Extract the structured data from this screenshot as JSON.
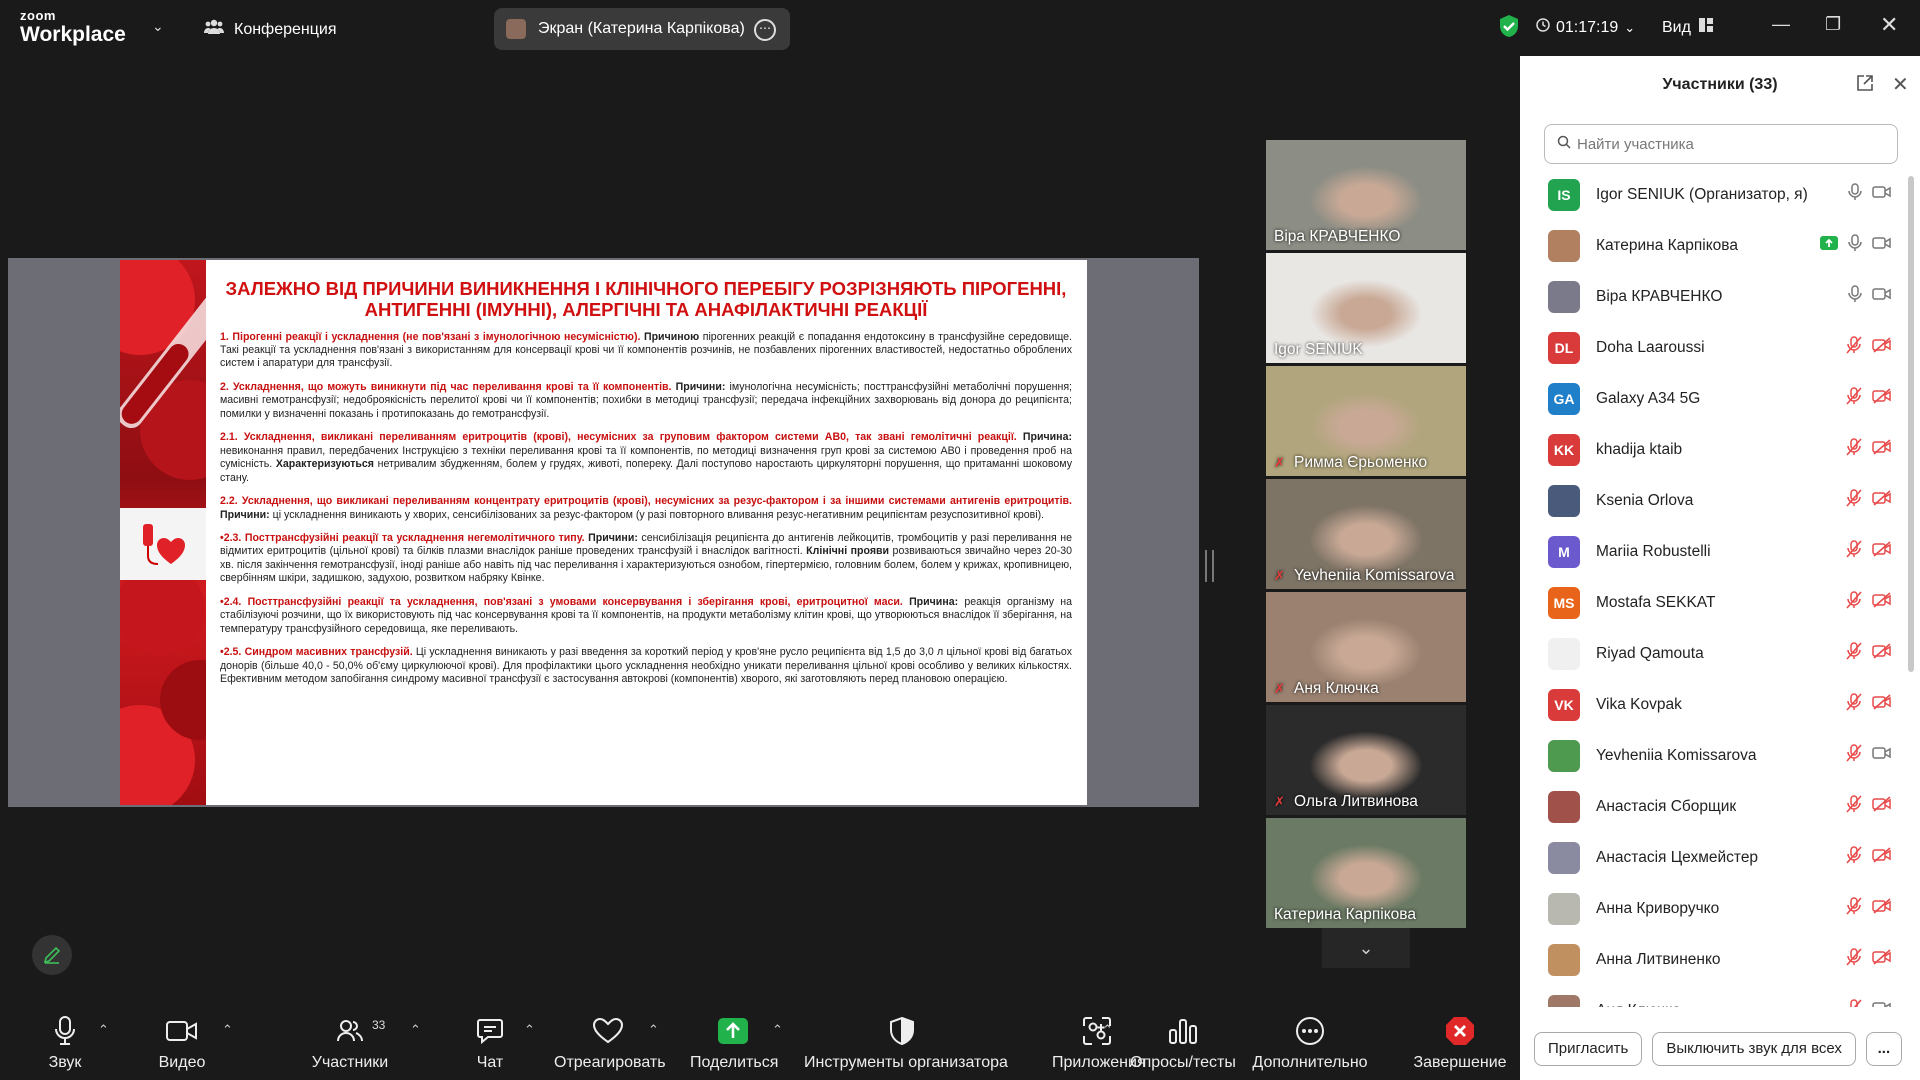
{
  "app": {
    "logo_line1": "zoom",
    "logo_line2": "Workplace",
    "meeting_label": "Конференция",
    "share_pill": "Экран (Катерина Карпікова)",
    "timer": "01:17:19",
    "view_label": "Вид"
  },
  "slide": {
    "title": "ЗАЛЕЖНО ВІД ПРИЧИНИ ВИНИКНЕННЯ І КЛІНІЧНОГО ПЕРЕБІГУ РОЗРІЗНЯЮТЬ ПІРОГЕННІ, АНТИГЕННІ (ІМУННІ), АЛЕРГІЧНІ ТА АНАФІЛАКТИЧНІ РЕАКЦІЇ",
    "p1_head": "1. Пірогенні реакції і ускладнення (не пов'язані з імунологічною несумісністю).",
    "p1_label": " Причиною",
    "p1_text": " пірогенних реакцій є попадання ендотоксину в трансфузійне середовище. Такі реакції та ускладнення пов'язані з використанням для консервації крові чи її компонентів розчинів, не позбавлених пірогенних властивостей, недостатньо оброблених систем і апаратури для трансфузії.",
    "p2_head": "2. Ускладнення, що можуть виникнути під час переливання крові та її компонентів.",
    "p2_label": " Причини:",
    "p2_text": " імунологічна несумісність; посттрансфузійні метаболічні порушення; масивні гемотрансфузії; недоброякісність перелитої крові чи її компонентів; похибки в методиці трансфузії; передача інфекційних захворювань від донора до реципієнта; помилки у визначенні показань і протипоказань до гемотрансфузії.",
    "p21_head": "2.1. Ускладнення, викликані переливанням еритроцитів (крові), несумісних за груповим фактором системи АВ0, так звані гемолітичні реакції.",
    "p21_label": " Причина:",
    "p21_text": " невиконання правил, передбачених Інструкцією з техніки переливання крові та її компонентів, по методиці визначення груп крові за системою АВ0 і проведення проб на сумісність.",
    "p21_label2": " Характеризуються",
    "p21_text2": " нетривалим збудженням, болем у грудях, животі, попереку. Далі поступово наростають циркуляторні порушення, що притаманні шоковому стану.",
    "p22_head": "2.2. Ускладнення, що викликані переливанням концентрату еритроцитів (крові), несумісних за резус-фактором і за іншими системами антигенів еритроцитів.",
    "p22_label": " Причини:",
    "p22_text": " ці ускладнення виникають у хворих, сенсибілізованих за резус-фактором (у разі повторного вливання резус-негативним реципієнтам резуспозитивної крові).",
    "p23_head": "•2.3. Посттрансфузійні реакції та ускладнення негемолітичного типу.",
    "p23_label": " Причини:",
    "p23_text": " сенсибілізація реципієнта до антигенів лейкоцитів, тромбоцитів у разі переливання не відмитих еритроцитів (цільної крові) та білків плазми внаслідок раніше проведених трансфузій і внаслідок вагітності.",
    "p23_label2": " Клінічні прояви",
    "p23_text2": " розвиваються звичайно через 20-30 хв. після закінчення гемотрансфузії, іноді раніше або навіть під час переливання і характеризуються ознобом, гіпертермією, головним болем, болем у крижах, кропивницею, свербінням шкіри, задишкою, задухою, розвитком набряку Квінке.",
    "p24_head": "•2.4. Посттрансфузійні реакції та ускладнення, пов'язані з умовами консервування і зберігання крові, еритроцитної маси.",
    "p24_label": " Причина:",
    "p24_text": " реакція організму на стабілізуючі розчини, що їх використовують під час консервування крові та її компонентів, на продукти метаболізму клітин крові, що утворюються внаслідок її зберігання, на температуру трансфузійного середовища, яке переливають.",
    "p25_head": "•2.5. Синдром масивних трансфузій.",
    "p25_text": " Ці ускладнення виникають у разі введення за короткий період у кров'яне русло реципієнта від 1,5 до 3,0 л цільної крові від багатьох донорів (більше 40,0 - 50,0% об'єму циркулюючої крові). Для профілактики цього ускладнення необхідно уникати переливання цільної крові особливо у великих кількостях. Ефективним методом запобігання синдрому масивної трансфузії є застосування автокрові (компонентів) хворого, які заготовляють перед плановою операцією."
  },
  "tiles": [
    {
      "name": "Віра КРАВЧЕНКО",
      "muted": false,
      "bg": "#8c8d84"
    },
    {
      "name": "Igor SENIUK",
      "muted": false,
      "bg": "#e9e7e4"
    },
    {
      "name": "Римма Єрьоменко",
      "muted": true,
      "bg": "#b0a57c"
    },
    {
      "name": "Yevheniia Komissarova",
      "muted": true,
      "bg": "#7e7466"
    },
    {
      "name": "Аня Ключка",
      "muted": true,
      "bg": "#9a8170"
    },
    {
      "name": "Ольга Литвинова",
      "muted": true,
      "bg": "#2b2b2b"
    },
    {
      "name": "Катерина Карпікова",
      "muted": false,
      "bg": "#6b7a64"
    }
  ],
  "panel": {
    "title": "Участники (33)",
    "search_placeholder": "Найти участника",
    "invite_button": "Пригласить",
    "mute_all_button": "Выключить звук для всех",
    "more_button": "..."
  },
  "participants": [
    {
      "name": "Igor SENIUK (Организатор, я)",
      "initials": "IS",
      "color": "#22a350",
      "mic": "on",
      "cam": "off-plain"
    },
    {
      "name": "Катерина Карпікова",
      "initials": "",
      "color": "#b08060",
      "mic": "on",
      "cam": "off-plain",
      "sharing": true
    },
    {
      "name": "Віра КРАВЧЕНКО",
      "initials": "",
      "color": "#7a7a8a",
      "mic": "on",
      "cam": "off-plain"
    },
    {
      "name": "Doha Laaroussi",
      "initials": "DL",
      "color": "#d93b3b",
      "mic": "muted",
      "cam": "muted"
    },
    {
      "name": "Galaxy A34 5G",
      "initials": "GA",
      "color": "#1f7fc9",
      "mic": "muted",
      "cam": "muted"
    },
    {
      "name": "khadija ktaib",
      "initials": "KK",
      "color": "#d93b3b",
      "mic": "muted",
      "cam": "muted"
    },
    {
      "name": "Ksenia Orlova",
      "initials": "",
      "color": "#4a5a7a",
      "mic": "muted",
      "cam": "muted"
    },
    {
      "name": "Mariia Robustelli",
      "initials": "M",
      "color": "#6a5acd",
      "mic": "muted",
      "cam": "muted"
    },
    {
      "name": "Mostafa SEKKAT",
      "initials": "MS",
      "color": "#e8641a",
      "mic": "muted",
      "cam": "muted"
    },
    {
      "name": "Riyad Qamouta",
      "initials": "",
      "color": "#f0f0f0",
      "mic": "muted",
      "cam": "muted"
    },
    {
      "name": "Vika Kovpak",
      "initials": "VK",
      "color": "#d93b3b",
      "mic": "muted",
      "cam": "muted"
    },
    {
      "name": "Yevheniia Komissarova",
      "initials": "",
      "color": "#4e9a4e",
      "mic": "muted",
      "cam": "off-plain"
    },
    {
      "name": "Анастасія Сборщик",
      "initials": "",
      "color": "#a0524a",
      "mic": "muted",
      "cam": "muted"
    },
    {
      "name": "Анастасія Цехмейстер",
      "initials": "",
      "color": "#8a8aa0",
      "mic": "muted",
      "cam": "muted"
    },
    {
      "name": "Анна Криворучко",
      "initials": "",
      "color": "#b8b8b0",
      "mic": "muted",
      "cam": "muted"
    },
    {
      "name": "Анна Литвиненко",
      "initials": "",
      "color": "#c09060",
      "mic": "muted",
      "cam": "muted"
    },
    {
      "name": "Аня Ключка",
      "initials": "",
      "color": "#a07868",
      "mic": "muted",
      "cam": "off-plain"
    }
  ],
  "toolbar": {
    "audio": "Звук",
    "video": "Видео",
    "participants": "Участники",
    "participants_count": "33",
    "chat": "Чат",
    "react": "Отреагировать",
    "share": "Поделиться",
    "host_tools": "Инструменты организатора",
    "apps": "Приложения",
    "polls": "Опросы/тесты",
    "more": "Дополнительно",
    "end": "Завершение"
  }
}
